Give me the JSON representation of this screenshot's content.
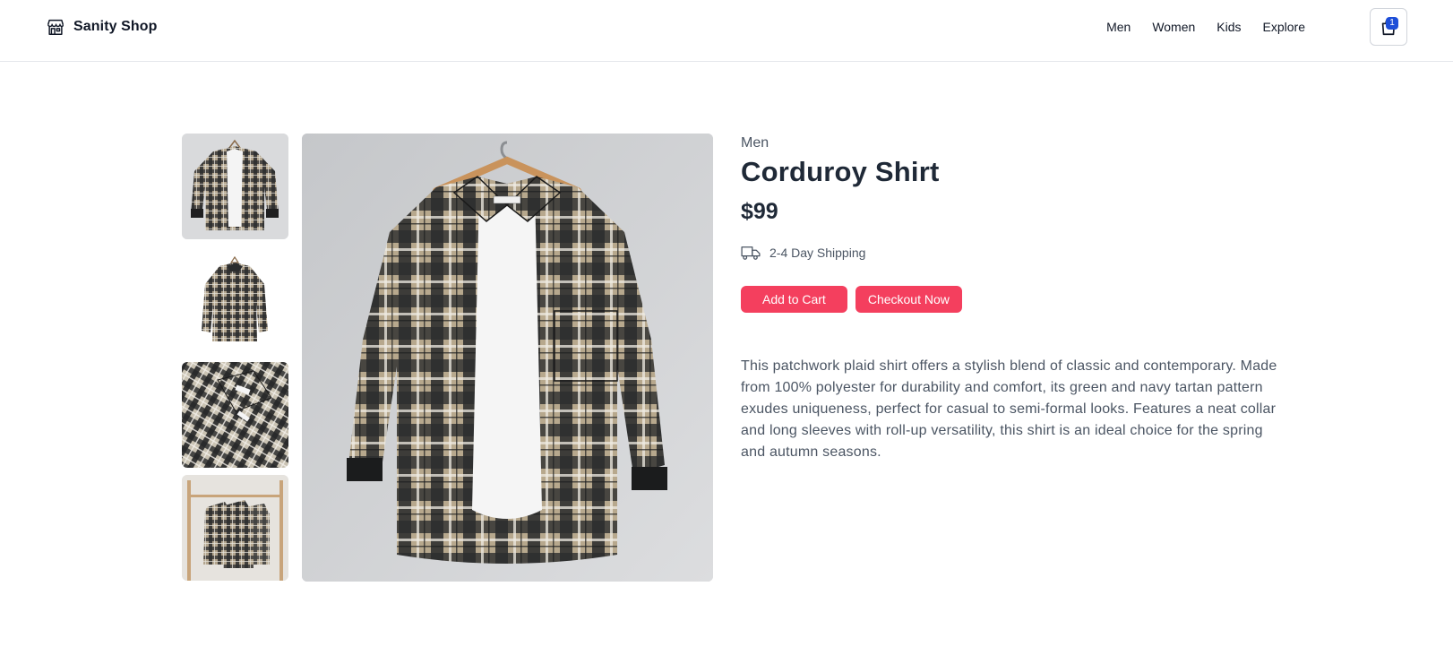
{
  "header": {
    "brand_name": "Sanity Shop",
    "nav_items": [
      "Men",
      "Women",
      "Kids",
      "Explore"
    ],
    "cart_count": "1"
  },
  "gallery": {
    "thumbnails": [
      "shirt-front",
      "shirt-back",
      "shirt-collar-detail",
      "shirts-on-rack"
    ],
    "main_image": "plaid-shirt-on-hanger"
  },
  "product": {
    "category": "Men",
    "title": "Corduroy Shirt",
    "price": "$99",
    "shipping": "2-4 Day Shipping",
    "add_to_cart_label": "Add to Cart",
    "checkout_label": "Checkout Now",
    "description": "This patchwork plaid shirt offers a stylish blend of classic and contemporary. Made from 100% polyester for durability and comfort, its green and navy tartan pattern exudes uniqueness, perfect for casual to semi-formal looks. Features a neat collar and long sleeves with roll-up versatility, this shirt is an ideal choice for the spring and autumn seasons."
  },
  "colors": {
    "accent": "#f43f5e",
    "badge": "#1d4ed8",
    "text_primary": "#1f2937",
    "text_muted": "#4b5563",
    "border": "#e5e7eb"
  }
}
